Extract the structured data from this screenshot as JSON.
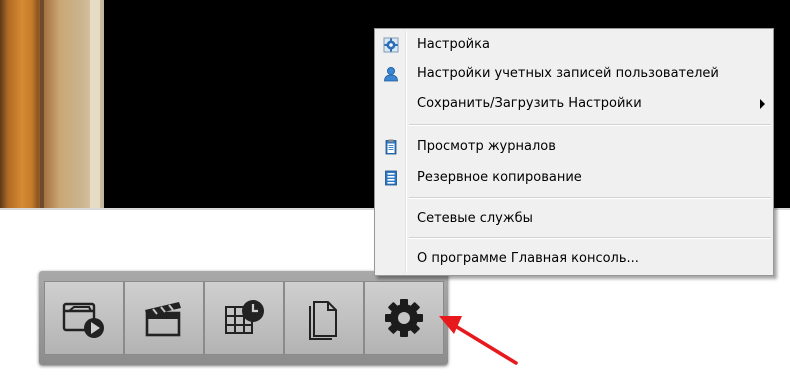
{
  "menu": {
    "items": [
      {
        "label": "Настройка",
        "icon": "gear-settings-icon"
      },
      {
        "label": "Настройки учетных записей пользователей",
        "icon": "user-icon"
      },
      {
        "label": "Сохранить/Загрузить Настройки",
        "icon": "",
        "submenu": true
      },
      {
        "label": "Просмотр журналов",
        "icon": "log-clipboard-icon"
      },
      {
        "label": "Резервное копирование",
        "icon": "backup-icon"
      },
      {
        "label": "Сетевые службы",
        "icon": ""
      },
      {
        "label": "О программе Главная консоль...",
        "icon": ""
      }
    ]
  },
  "toolbar": {
    "buttons": [
      {
        "icon": "playback-icon"
      },
      {
        "icon": "clapperboard-icon"
      },
      {
        "icon": "schedule-icon"
      },
      {
        "icon": "document-icon"
      },
      {
        "icon": "settings-gear-icon"
      }
    ]
  },
  "colors": {
    "annotation_arrow": "#e8191d",
    "menu_background": "#f0f0f0",
    "toolbar_background": "#9a9a9a"
  }
}
